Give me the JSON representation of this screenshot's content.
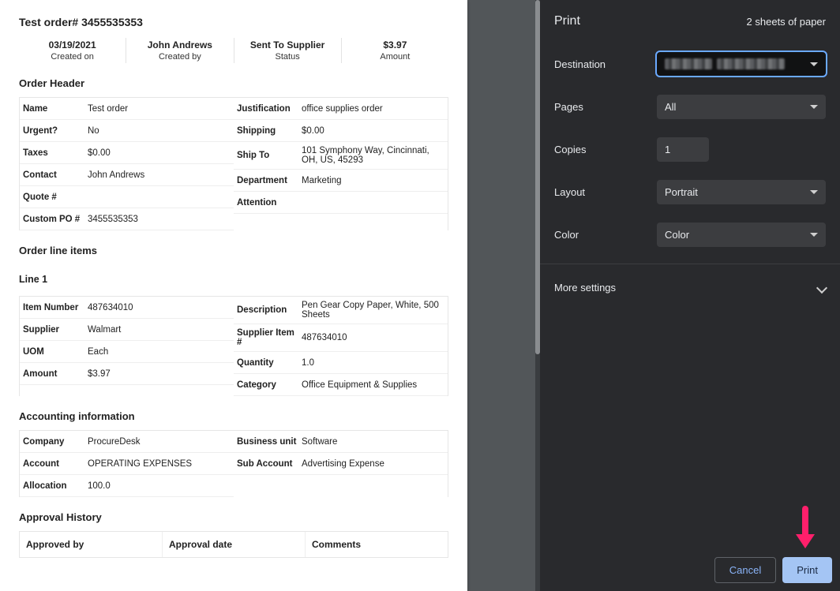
{
  "document": {
    "title_prefix": "Test order#",
    "order_number": "3455535353",
    "summary": [
      {
        "value": "03/19/2021",
        "label": "Created on"
      },
      {
        "value": "John Andrews",
        "label": "Created by"
      },
      {
        "value": "Sent To Supplier",
        "label": "Status"
      },
      {
        "value": "$3.97",
        "label": "Amount"
      }
    ],
    "order_header_title": "Order Header",
    "order_header_left": [
      {
        "k": "Name",
        "v": "Test order"
      },
      {
        "k": "Urgent?",
        "v": "No"
      },
      {
        "k": "Taxes",
        "v": "$0.00"
      },
      {
        "k": "Contact",
        "v": "John Andrews"
      },
      {
        "k": "Quote #",
        "v": ""
      },
      {
        "k": "Custom PO #",
        "v": "3455535353"
      }
    ],
    "order_header_right": [
      {
        "k": "Justification",
        "v": "office supplies order"
      },
      {
        "k": "Shipping",
        "v": "$0.00"
      },
      {
        "k": "Ship To",
        "v": "101 Symphony Way, Cincinnati, OH, US, 45293"
      },
      {
        "k": "Department",
        "v": "Marketing"
      },
      {
        "k": "Attention",
        "v": ""
      }
    ],
    "line_items_title": "Order line items",
    "line1_label": "Line 1",
    "line1_left": [
      {
        "k": "Item Number",
        "v": "487634010"
      },
      {
        "k": "Supplier",
        "v": "Walmart"
      },
      {
        "k": "UOM",
        "v": "Each"
      },
      {
        "k": "Amount",
        "v": "$3.97"
      }
    ],
    "line1_right": [
      {
        "k": "Description",
        "v": "Pen Gear Copy Paper, White, 500 Sheets"
      },
      {
        "k": "Supplier Item #",
        "v": "487634010"
      },
      {
        "k": "Quantity",
        "v": "1.0"
      },
      {
        "k": "Category",
        "v": "Office Equipment & Supplies"
      }
    ],
    "accounting_title": "Accounting information",
    "accounting_left": [
      {
        "k": "Company",
        "v": "ProcureDesk"
      },
      {
        "k": "Account",
        "v": "OPERATING EXPENSES"
      },
      {
        "k": "Allocation",
        "v": "100.0"
      }
    ],
    "accounting_right": [
      {
        "k": "Business unit",
        "v": "Software"
      },
      {
        "k": "Sub Account",
        "v": "Advertising Expense"
      }
    ],
    "approval_title": "Approval History",
    "approval_headers": [
      "Approved by",
      "Approval date",
      "Comments"
    ]
  },
  "print_dialog": {
    "title": "Print",
    "subtitle": "2 sheets of paper",
    "rows": {
      "destination_label": "Destination",
      "pages_label": "Pages",
      "pages_value": "All",
      "copies_label": "Copies",
      "copies_value": "1",
      "layout_label": "Layout",
      "layout_value": "Portrait",
      "color_label": "Color",
      "color_value": "Color"
    },
    "more_settings": "More settings",
    "cancel": "Cancel",
    "print": "Print"
  }
}
